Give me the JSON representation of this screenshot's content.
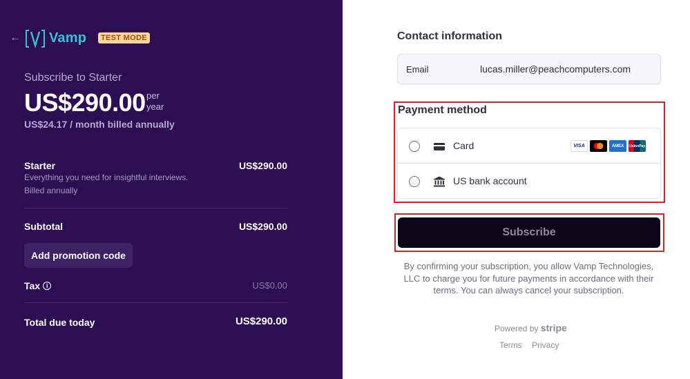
{
  "header": {
    "back_arrow": "←",
    "brand_name": "Vamp",
    "test_mode": "TEST MODE"
  },
  "summary": {
    "subscribe_title": "Subscribe to Starter",
    "price": "US$290.00",
    "per": "per",
    "period": "year",
    "monthly_note": "US$24.17 / month billed annually",
    "line_item": {
      "name": "Starter",
      "description": "Everything you need for insightful interviews.",
      "billing": "Billed annually",
      "price": "US$290.00"
    },
    "subtotal_label": "Subtotal",
    "subtotal_value": "US$290.00",
    "promo_button": "Add promotion code",
    "tax_label": "Tax",
    "tax_info_icon": "i",
    "tax_value": "US$0.00",
    "total_label": "Total due today",
    "total_value": "US$290.00"
  },
  "contact": {
    "title": "Contact information",
    "email_label": "Email",
    "email_value": "lucas.miller@peachcomputers.com"
  },
  "payment": {
    "title": "Payment method",
    "options": [
      {
        "label": "Card",
        "icon": "credit-card-icon"
      },
      {
        "label": "US bank account",
        "icon": "bank-icon"
      }
    ],
    "card_brands": [
      "VISA",
      "mastercard",
      "AMEX",
      "UnionPay"
    ]
  },
  "actions": {
    "subscribe_label": "Subscribe"
  },
  "legal": {
    "text": "By confirming your subscription, you allow Vamp Technologies, LLC to charge you for future payments in accordance with their terms. You can always cancel your subscription."
  },
  "footer": {
    "powered_by": "Powered by",
    "stripe": "stripe",
    "terms": "Terms",
    "privacy": "Privacy"
  },
  "colors": {
    "left_panel_bg": "#2d0e53",
    "brand_accent": "#33c4d8",
    "test_mode_bg": "#ffd79b",
    "subscribe_bg": "#0b0617",
    "highlight_border": "#e0201e"
  }
}
